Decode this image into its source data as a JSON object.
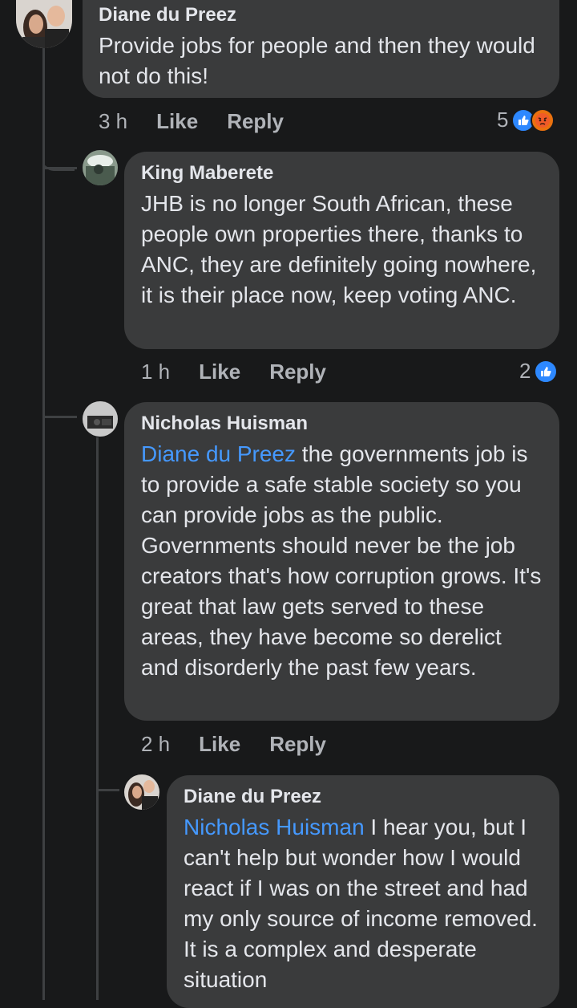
{
  "comments": [
    {
      "author": "Diane du Preez",
      "text": "Provide jobs for people and then they would not do this!",
      "time": "3 h",
      "like_label": "Like",
      "reply_label": "Reply",
      "reaction_count": "5",
      "reactions": [
        "like-icon",
        "angry-icon"
      ]
    },
    {
      "author": "King Maberete",
      "text": "JHB is no longer South African, these people own properties there, thanks to ANC, they are definitely going nowhere, it is their place now, keep voting ANC.",
      "time": "1 h",
      "like_label": "Like",
      "reply_label": "Reply",
      "reaction_count": "2",
      "reactions": [
        "like-icon"
      ]
    },
    {
      "author": "Nicholas Huisman",
      "mention": "Diane du Preez",
      "text": " the governments job is to provide a safe stable society so you can provide jobs as the public. Governments should never be the job creators that's how corruption grows.  It's great that law gets served to these areas, they have become so derelict and disorderly the past few years.",
      "time": "2 h",
      "like_label": "Like",
      "reply_label": "Reply"
    },
    {
      "author": "Diane du Preez",
      "mention": "Nicholas Huisman",
      "text": " I hear you, but I can't help but wonder how I would react if I was on the street and had my only source of income removed. It is a complex and desperate situation"
    }
  ],
  "colors": {
    "background": "#18191a",
    "bubble": "#3a3b3c",
    "mention": "#4599ff",
    "like_reaction": "#2d88ff",
    "angry_reaction": "#e9710f"
  }
}
